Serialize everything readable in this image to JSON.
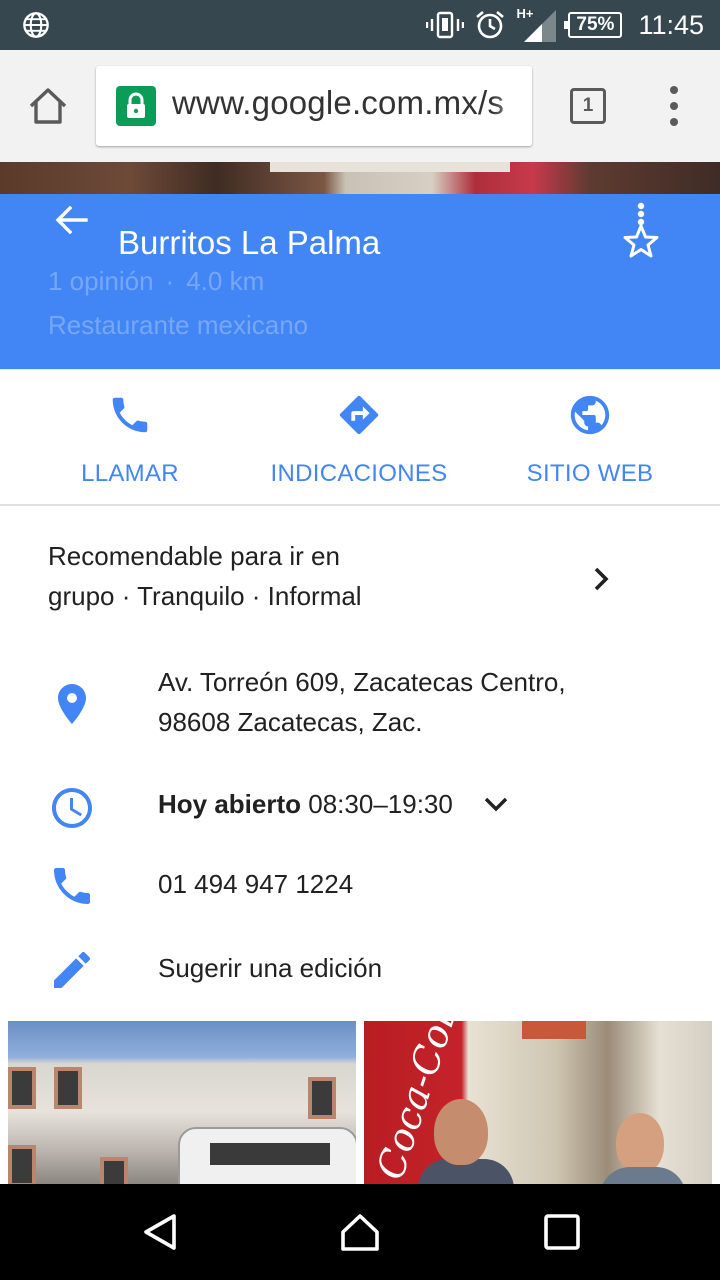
{
  "status_bar": {
    "time": "11:45",
    "battery": "75%",
    "network": "H+",
    "icons": [
      "globe-icon",
      "vibrate-icon",
      "alarm-icon",
      "signal-icon",
      "battery-icon"
    ]
  },
  "browser": {
    "url": "www.google.com.mx/s",
    "tab_count": "1",
    "icons": [
      "home-icon",
      "lock-icon",
      "tabs-icon",
      "overflow-menu-icon"
    ]
  },
  "place": {
    "name": "Burritos La Palma",
    "reviews": "1 opinión",
    "separator": "·",
    "distance": "4.0 km",
    "category": "Restaurante mexicano"
  },
  "actions": {
    "call_label": "LLAMAR",
    "directions_label": "INDICACIONES",
    "website_label": "SITIO WEB"
  },
  "details": {
    "summary_line1": "Recomendable para ir en",
    "summary_line2": "grupo · Tranquilo · Informal",
    "address_line1": "Av. Torreón 609, Zacatecas Centro,",
    "address_line2": "98608 Zacatecas, Zac.",
    "hours_status": "Hoy abierto",
    "hours_range": " 08:30–19:30",
    "phone": "01 494 947 1224",
    "suggest_edit": "Sugerir una edición"
  },
  "photos": {
    "interior_logo": "Coca-Cola"
  },
  "colors": {
    "accent": "#4285f4",
    "status_bar": "#37474f",
    "toolbar": "#f2f2f2",
    "lock": "#0b9d58"
  }
}
